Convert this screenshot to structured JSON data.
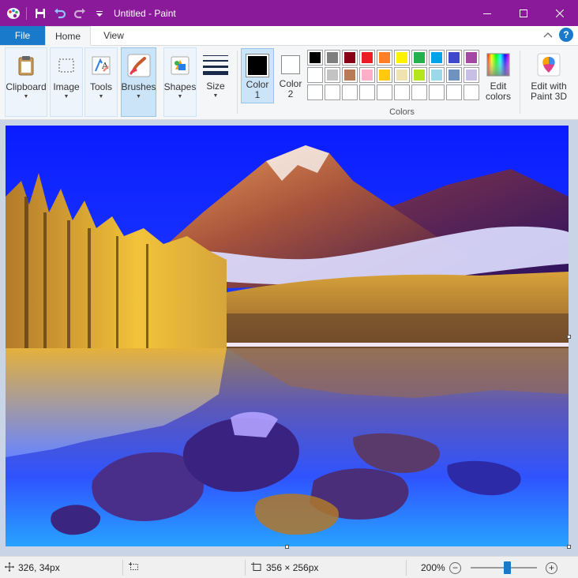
{
  "window": {
    "title": "Untitled - Paint",
    "accent_color": "#8b1a9a"
  },
  "quick_access": {
    "icons": [
      "paint-app-icon",
      "save-icon",
      "undo-icon",
      "redo-icon",
      "customize-dropdown-icon"
    ]
  },
  "tabs": {
    "file": "File",
    "home": "Home",
    "view": "View"
  },
  "ribbon": {
    "clipboard": "Clipboard",
    "image": "Image",
    "tools": "Tools",
    "brushes": "Brushes",
    "shapes": "Shapes",
    "size": "Size",
    "color1_line1": "Color",
    "color1_line2": "1",
    "color2_line1": "Color",
    "color2_line2": "2",
    "edit_colors_line1": "Edit",
    "edit_colors_line2": "colors",
    "paint3d_line1": "Edit with",
    "paint3d_line2": "Paint 3D",
    "colors_group": "Colors",
    "color1_value": "#000000",
    "color2_value": "#ffffff",
    "palette_row1": [
      "#000000",
      "#7f7f7f",
      "#880015",
      "#ed1c24",
      "#ff7f27",
      "#fff200",
      "#22b14c",
      "#00a2e8",
      "#3f48cc",
      "#a349a4"
    ],
    "palette_row2": [
      "#ffffff",
      "#c3c3c3",
      "#b97a57",
      "#ffaec9",
      "#ffc90e",
      "#efe4b0",
      "#b5e61d",
      "#99d9ea",
      "#7092be",
      "#c8bfe7"
    ],
    "palette_row3": [
      "",
      "",
      "",
      "",
      "",
      "",
      "",
      "",
      "",
      ""
    ]
  },
  "status": {
    "cursor_pos": "326, 34px",
    "image_size": "356 × 256px",
    "zoom": "200%",
    "zoom_out": "−",
    "zoom_in": "+"
  }
}
